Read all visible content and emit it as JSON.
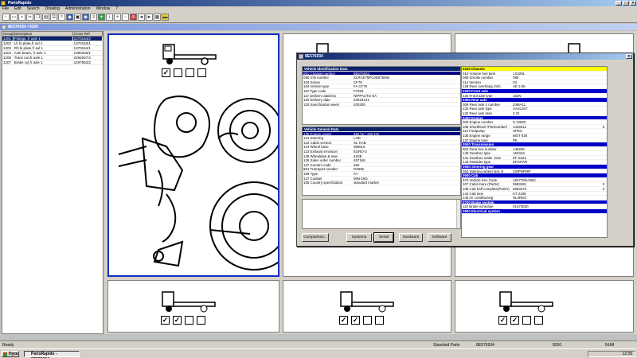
{
  "app": {
    "title": "PartsRapido",
    "mdi_title": "8E576934 / 8200"
  },
  "menu": [
    "File",
    "Edit",
    "Search",
    "Drawing",
    "Administration",
    "Window",
    "?"
  ],
  "left_list": {
    "headers": [
      "Group",
      "Description",
      "Cross Ref"
    ],
    "rows": [
      {
        "g": "1201",
        "d": "Fittings, fr axle 1",
        "c": "1370164/2",
        "sel": true
      },
      {
        "g": "1202",
        "d": "Lh bi plate,fr axl 1",
        "c": "1370163/1"
      },
      {
        "g": "1203",
        "d": "Rh bi plate,fr axl 1",
        "c": "1370164/1"
      },
      {
        "g": "1204",
        "d": "Axle beam, fr axle 1",
        "c": "1380325/1"
      },
      {
        "g": "1205",
        "d": "Track rod,fr axle 1",
        "c": "0292937/4"
      },
      {
        "g": "1207",
        "d": "Brake cyl,fr axle 1",
        "c": "1297562/2"
      }
    ]
  },
  "dialog": {
    "title": "8E576934",
    "vin_title": "Vehicle Identification Data",
    "vin_rows": [
      {
        "k": "001 Chassis number",
        "v": "8E576934",
        "sel": true
      },
      {
        "k": "080 VIN number",
        "v": "XLRAE75PC0E576934"
      },
      {
        "k": "103 Series",
        "v": "CF75"
      },
      {
        "k": "104 Vehicle type",
        "v": "FA CF75"
      },
      {
        "k": "110 Type code",
        "v": "F7925"
      },
      {
        "k": "117 Delivery address",
        "v": "NIPPAUTO SA"
      },
      {
        "k": "119 Delivery date",
        "v": "20020131"
      },
      {
        "k": "120 Specification week",
        "v": "200205"
      }
    ],
    "gen_title": "Vehicle General Data",
    "gen_rows": [
      {
        "k": "125 Engine power",
        "v": "360 hp / 265 kW",
        "sel": true
      },
      {
        "k": "121 Steering",
        "v": "LHD"
      },
      {
        "k": "122 Cabin version",
        "v": "SL-KAB"
      },
      {
        "k": "124 Wheel base",
        "v": "WB610"
      },
      {
        "k": "122 Exhaust emission",
        "v": "EURO-3"
      },
      {
        "k": "125 Wheelplan & type",
        "v": "4X2E"
      },
      {
        "k": "126 Sales order number",
        "v": "457168"
      },
      {
        "k": "127 Country code",
        "v": "462"
      },
      {
        "k": "851 Transport number",
        "v": "R4835"
      },
      {
        "k": "159 Type",
        "v": "FA"
      },
      {
        "k": "127 Codiset",
        "v": "MIN-18G"
      },
      {
        "k": "105 Country specification",
        "v": "standard market"
      }
    ],
    "right_rows": [
      {
        "k": "0100  Chassis",
        "v": "",
        "t": "yel"
      },
      {
        "k": "010 Volume fuel tank",
        "v": "1X328L"
      },
      {
        "k": "065 Smoke number",
        "v": "080"
      },
      {
        "k": "114 Version",
        "v": "03"
      },
      {
        "k": "128 Rear overhang (AE)",
        "v": "AE 2.55"
      },
      {
        "k": "0200  Front axle",
        "v": "",
        "t": "blu"
      },
      {
        "k": "134 Front axle type",
        "v": "152N"
      },
      {
        "k": "0300  Rear axle",
        "v": "",
        "t": "blu"
      },
      {
        "k": "008 Rear axle 1 number",
        "v": "24MA11"
      },
      {
        "k": "132 Rear axle type",
        "v": "AAS1347"
      },
      {
        "k": "132 Rear axle ratio",
        "v": "3.31"
      },
      {
        "k": "0400  Engine",
        "v": "",
        "t": "blu"
      },
      {
        "k": "002 Engine number",
        "v": "S 12820"
      },
      {
        "k": "106 Shortblock (Partnumber)",
        "v": "1448312",
        "m": "X"
      },
      {
        "k": "113 Fuelpump",
        "v": "UPEC"
      },
      {
        "k": "136 Engine range",
        "v": "MOT 928"
      },
      {
        "k": "137 Engine type",
        "v": "PE"
      },
      {
        "k": "0500  Transmission",
        "v": "",
        "t": "blu"
      },
      {
        "k": "004 Gear box number",
        "v": "145200"
      },
      {
        "k": "140 Gearbox type",
        "v": "16S151"
      },
      {
        "k": "141 Gearbox make, type",
        "v": "ZF S151"
      },
      {
        "k": "143 Retarder type",
        "v": "ZFINTAR"
      },
      {
        "k": "0550  Steering gear",
        "v": "",
        "t": "blu"
      },
      {
        "k": "054 Steering wheel lock nr",
        "v": "CMPHPMP"
      },
      {
        "k": "0600  Cab",
        "v": "",
        "t": "blu"
      },
      {
        "k": "072 Vehicle Key Code",
        "v": "194776GA38C"
      },
      {
        "k": "107 Cabin bare (Partnr)",
        "v": "0683481",
        "m": "X"
      },
      {
        "k": "108 Cab half complete(Partnr)",
        "v": "0683473",
        "m": "X"
      },
      {
        "k": "144 Cab type",
        "v": "KT 2238"
      },
      {
        "k": "146 Air conditioning",
        "v": "HL4REG"
      },
      {
        "k": "0700  Brake system",
        "v": "",
        "t": "blu"
      },
      {
        "k": "110 Brake schedule",
        "v": "01373630"
      },
      {
        "k": "0800  Electrical system",
        "v": "",
        "t": "blu"
      }
    ],
    "buttons": {
      "comparison": "Comparison...",
      "systems": "Systems",
      "serial": "Serial",
      "hardware": "Hardware",
      "software": "Software"
    }
  },
  "status": {
    "left": "Ready",
    "mid1": "Standard Parts",
    "mid2": "8E576934",
    "mid3": "8200",
    "right": "NUM"
  },
  "taskbar": {
    "start": "Пуск",
    "item": "PartsRapido - 8E576934...",
    "clock": "12:39"
  }
}
